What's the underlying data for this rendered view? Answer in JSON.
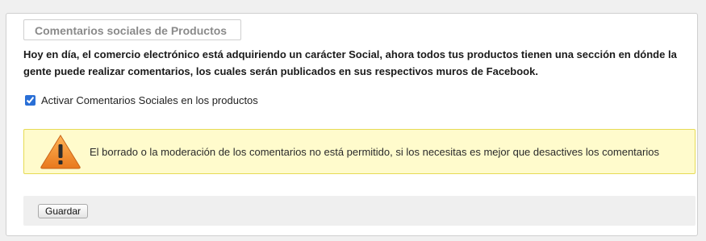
{
  "panel": {
    "title": "Comentarios sociales de Productos",
    "intro": "Hoy en día, el comercio electrónico está adquiriendo un carácter Social, ahora todos tus productos tienen una sección en dónde la gente puede realizar comentarios, los cuales serán publicados en sus respectivos muros de Facebook."
  },
  "option": {
    "label": "Activar Comentarios Sociales en los productos",
    "checked": true
  },
  "warning": {
    "icon": "warning-triangle-icon",
    "text": "El borrado o la moderación de los comentarios no está permitido, si los necesitas es mejor que desactives los comentarios",
    "background": "#fffbcc",
    "border": "#e6db55",
    "icon_color": "#f0892a"
  },
  "actions": {
    "save_label": "Guardar"
  }
}
